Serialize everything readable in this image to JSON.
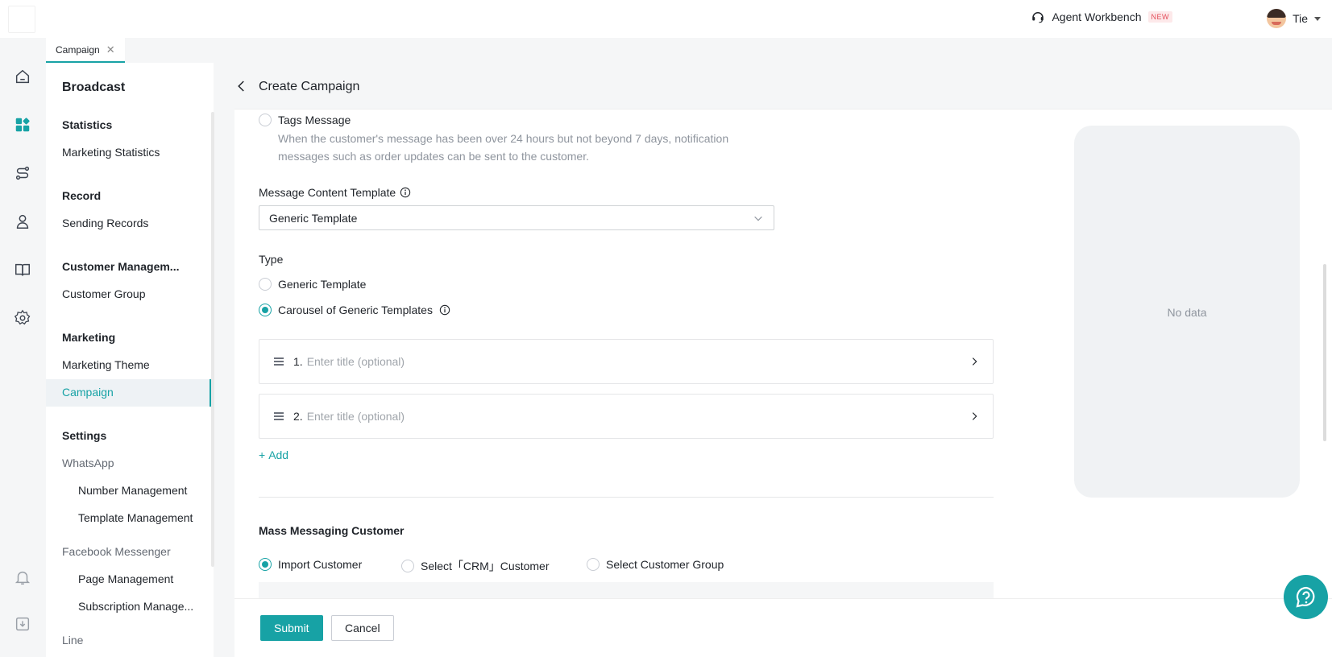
{
  "topbar": {
    "workbench_label": "Agent Workbench",
    "new_badge": "NEW",
    "user_name": "Tie"
  },
  "rail": {
    "icons": [
      "home-icon",
      "apps-icon",
      "route-icon",
      "customer-icon",
      "book-icon",
      "gear-icon",
      "bell-icon",
      "download-icon"
    ]
  },
  "tabs": [
    {
      "label": "Campaign"
    }
  ],
  "sidebar": {
    "title": "Broadcast",
    "groups": {
      "statistics": "Statistics",
      "record": "Record",
      "customer": "Customer Managem...",
      "marketing": "Marketing",
      "settings": "Settings"
    },
    "items": {
      "marketing_statistics": "Marketing Statistics",
      "sending_records": "Sending Records",
      "customer_group": "Customer Group",
      "marketing_theme": "Marketing Theme",
      "campaign": "Campaign",
      "whatsapp": "WhatsApp",
      "number_management": "Number Management",
      "template_management": "Template Management",
      "facebook_messenger": "Facebook Messenger",
      "page_management": "Page Management",
      "subscription_management": "Subscription Manage...",
      "line": "Line"
    }
  },
  "main": {
    "title": "Create Campaign",
    "tags_message": {
      "label": "Tags Message",
      "description": "When the customer's message has been over 24 hours but not beyond 7 days, notification messages such as order updates can be sent to the customer."
    },
    "template_label": "Message Content Template",
    "template_value": "Generic Template",
    "type_label": "Type",
    "type_options": [
      "Generic Template",
      "Carousel of Generic Templates"
    ],
    "type_selected": "Carousel of Generic Templates",
    "cards": [
      {
        "index": "1.",
        "placeholder": "Enter title (optional)"
      },
      {
        "index": "2.",
        "placeholder": "Enter title (optional)"
      }
    ],
    "add_label": "Add",
    "mass_title": "Mass Messaging Customer",
    "mass_options": [
      "Import Customer",
      "Select「CRM」Customer",
      "Select Customer Group"
    ],
    "mass_selected": "Import Customer",
    "preview_empty": "No data"
  },
  "footer": {
    "submit": "Submit",
    "cancel": "Cancel"
  },
  "colors": {
    "accent": "#17a2a5",
    "badge": "#e34d59"
  }
}
